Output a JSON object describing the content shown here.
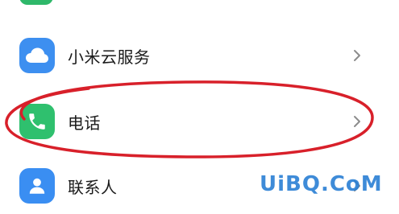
{
  "colors": {
    "cloud_icon_bg": "#3d8ff0",
    "phone_icon_bg": "#2fc06e",
    "contacts_icon_bg": "#3a8ef2",
    "highlight_ellipse": "#d8202a",
    "watermark": "#2a7fd4",
    "label_text": "#1a1a1a",
    "chevron": "#8c8c8c"
  },
  "settings_list": {
    "items": [
      {
        "label": "小米云服务",
        "icon": "cloud-icon"
      },
      {
        "label": "电话",
        "icon": "phone-icon",
        "highlighted": true
      },
      {
        "label": "联系人",
        "icon": "contact-person-icon"
      }
    ]
  },
  "watermark": {
    "text": "UiBQ.CoM"
  }
}
